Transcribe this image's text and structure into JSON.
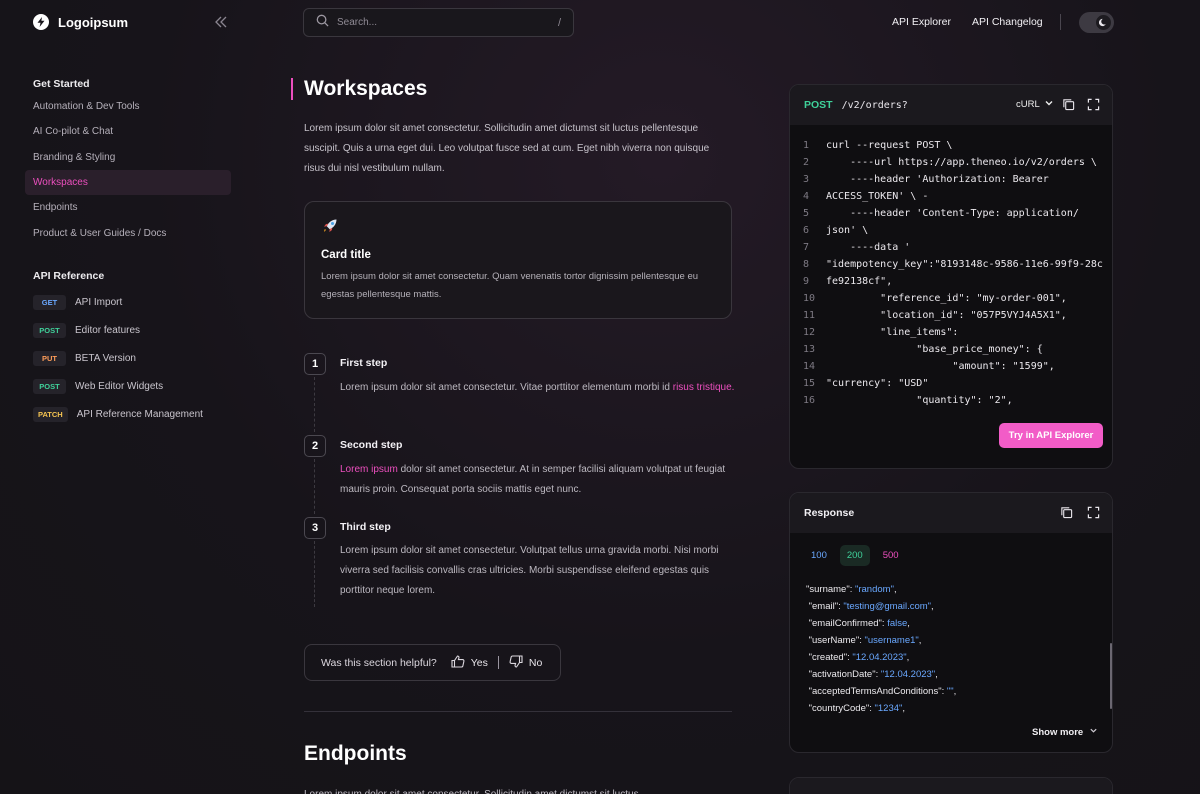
{
  "brand": {
    "name": "Logoipsum"
  },
  "search": {
    "placeholder": "Search...",
    "shortcut": "/"
  },
  "header": {
    "links": [
      "API Explorer",
      "API Changelog"
    ]
  },
  "sidebar": {
    "get_started_label": "Get Started",
    "items": [
      "Automation & Dev Tools",
      "AI Co-pilot & Chat",
      "Branding & Styling",
      "Workspaces",
      "Endpoints",
      "Product & User Guides / Docs"
    ],
    "active_item": "Workspaces",
    "api_reference_label": "API Reference",
    "api_items": [
      {
        "method": "GET",
        "label": "API Import"
      },
      {
        "method": "POST",
        "label": "Editor features"
      },
      {
        "method": "PUT",
        "label": "BETA Version"
      },
      {
        "method": "POST",
        "label": "Web Editor Widgets"
      },
      {
        "method": "PATCH",
        "label": "API Reference Management"
      }
    ]
  },
  "main": {
    "title": "Workspaces",
    "intro": "Lorem ipsum dolor sit amet consectetur. Sollicitudin amet dictumst sit luctus pellentesque suscipit. Quis a urna eget dui. Leo volutpat fusce sed at cum. Eget nibh viverra non quisque risus dui nisl vestibulum nullam.",
    "card": {
      "title": "Card title",
      "text": "Lorem ipsum dolor sit amet consectetur. Quam venenatis tortor dignissim pellentesque eu egestas pellentesque mattis."
    },
    "steps": [
      {
        "num": "1",
        "title": "First step",
        "text_before": "Lorem ipsum dolor sit amet consectetur. Vitae porttitor elementum morbi id ",
        "link": "risus tristique.",
        "text_after": ""
      },
      {
        "num": "2",
        "title": "Second step",
        "text_before": "",
        "link": "Lorem ipsum",
        "text_after": " dolor sit amet consectetur. At in semper facilisi aliquam volutpat ut feugiat mauris proin. Consequat porta sociis mattis eget nunc."
      },
      {
        "num": "3",
        "title": "Third step",
        "text_before": "Lorem ipsum dolor sit amet consectetur. Volutpat tellus urna gravida morbi. Nisi morbi viverra sed facilisis convallis cras ultricies. Morbi suspendisse eleifend egestas quis porttitor neque lorem.",
        "link": "",
        "text_after": ""
      }
    ],
    "feedback": {
      "question": "Was this section helpful?",
      "yes": "Yes",
      "no": "No"
    },
    "next_title": "Endpoints",
    "next_intro": "Lorem ipsum dolor sit amet consectetur. Sollicitudin amet dictumst sit luctus"
  },
  "request_panel": {
    "method": "POST",
    "endpoint": "/v2/orders?",
    "language": "cURL",
    "lines": [
      "curl --request POST \\",
      "    ----url https://app.theneo.io/v2/orders \\",
      "    ----header 'Authorization: Bearer",
      "ACCESS_TOKEN' \\ -",
      "    ----header 'Content-Type: application/",
      "json' \\",
      "    ----data '",
      "\"idempotency_key\":\"8193148c-9586-11e6-99f9-28c",
      "fe92138cf\",",
      "         \"reference_id\": \"my-order-001\",",
      "         \"location_id\": \"057P5VYJ4A5X1\",",
      "         \"line_items\":",
      "               \"base_price_money\": {",
      "                     \"amount\": \"1599\",",
      "\"currency\": \"USD\"",
      "               \"quantity\": \"2\","
    ],
    "try_label": "Try in API Explorer"
  },
  "response_panel": {
    "title": "Response",
    "tabs": [
      "100",
      "200",
      "500"
    ],
    "active_tab": "200",
    "lines": [
      {
        "key": "\"surname\": ",
        "value": "\"random\"",
        "end": ","
      },
      {
        "key": " \"email\": ",
        "value": "\"testing@gmail.com\"",
        "end": ","
      },
      {
        "key": " \"emailConfirmed\": ",
        "value": "false",
        "end": ","
      },
      {
        "key": " \"userName\": ",
        "value": "\"username1\"",
        "end": ","
      },
      {
        "key": " \"created\": ",
        "value": "\"12.04.2023\"",
        "end": ","
      },
      {
        "key": " \"activationDate\": ",
        "value": "\"12.04.2023\"",
        "end": ","
      },
      {
        "key": " \"acceptedTermsAndConditions\": ",
        "value": "\"\"",
        "end": ","
      },
      {
        "key": " \"countryCode\": ",
        "value": "\"1234\"",
        "end": ","
      }
    ],
    "show_more": "Show more"
  },
  "colors": {
    "accent": "#ec4fbe",
    "post": "#3fd19a",
    "get": "#6aa8ff"
  }
}
